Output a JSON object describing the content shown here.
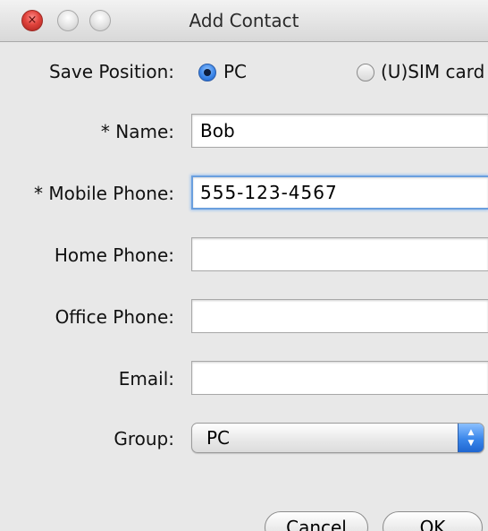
{
  "window": {
    "title": "Add Contact",
    "close_glyph": "×"
  },
  "save_position": {
    "label": "Save Position:",
    "options": [
      {
        "label": "PC",
        "selected": true
      },
      {
        "label": "(U)SIM card",
        "selected": false
      }
    ]
  },
  "fields": {
    "name": {
      "label": "* Name:",
      "value": "Bob"
    },
    "mobile_phone": {
      "label": "* Mobile Phone:",
      "value": "555-123-4567",
      "focused": true
    },
    "home_phone": {
      "label": "Home Phone:",
      "value": ""
    },
    "office_phone": {
      "label": "Office Phone:",
      "value": ""
    },
    "email": {
      "label": "Email:",
      "value": ""
    }
  },
  "group": {
    "label": "Group:",
    "selected": "PC"
  },
  "buttons": {
    "cancel": "Cancel",
    "ok": "OK"
  },
  "colors": {
    "accent": "#3a86ea",
    "focus_ring": "#6a9fde",
    "close_button": "#e0433c"
  }
}
